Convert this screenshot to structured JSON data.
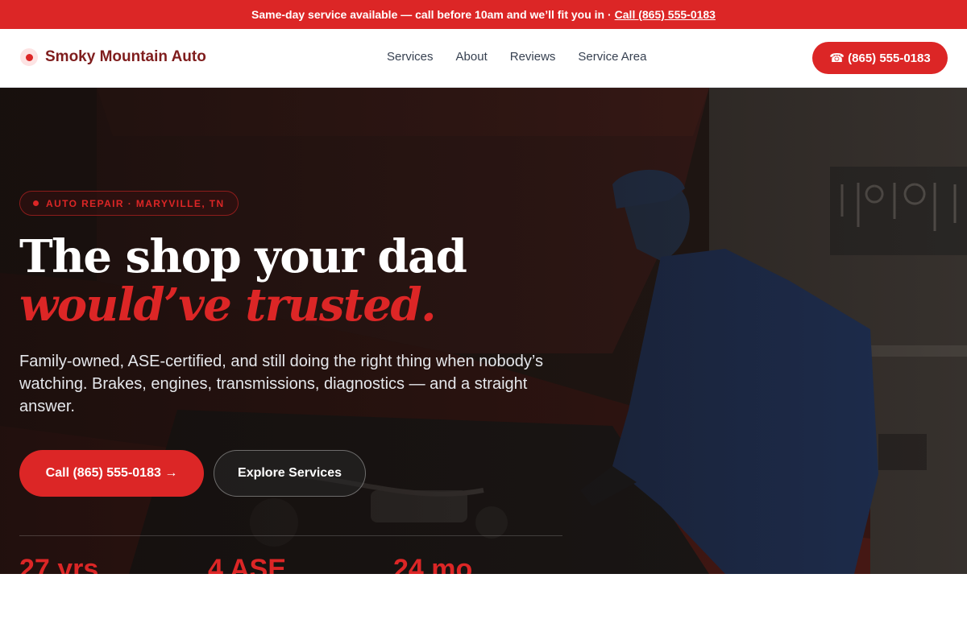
{
  "announcement": {
    "text": "Same-day service available — call before 10am and we’ll fit you in ·",
    "link": "Call (865) 555-0183"
  },
  "brand": {
    "name": "Smoky Mountain Auto"
  },
  "nav": {
    "links": [
      "Services",
      "About",
      "Reviews",
      "Service Area"
    ],
    "cta": "☎ (865) 555-0183"
  },
  "hero": {
    "badge": "AUTO REPAIR · MARYVILLE, TN",
    "title_plain": "The shop your dad",
    "title_accent": "would’ve trusted.",
    "subtitle": "Family-owned, ASE-certified, and still doing the right thing when nobody’s watching. Brakes, engines, transmissions, diagnostics — and a straight answer.",
    "primary_button": "Call (865) 555-0183 →",
    "secondary_button": "Explore Services",
    "stats": [
      "27 yrs",
      "4 ASE",
      "24 mo"
    ]
  },
  "colors": {
    "accent": "#dc2626",
    "brand_text": "#7f1d1d"
  },
  "icons": {
    "phone": "phone-icon",
    "brand": "brand-dot-icon",
    "arrow": "arrow-right-icon"
  }
}
